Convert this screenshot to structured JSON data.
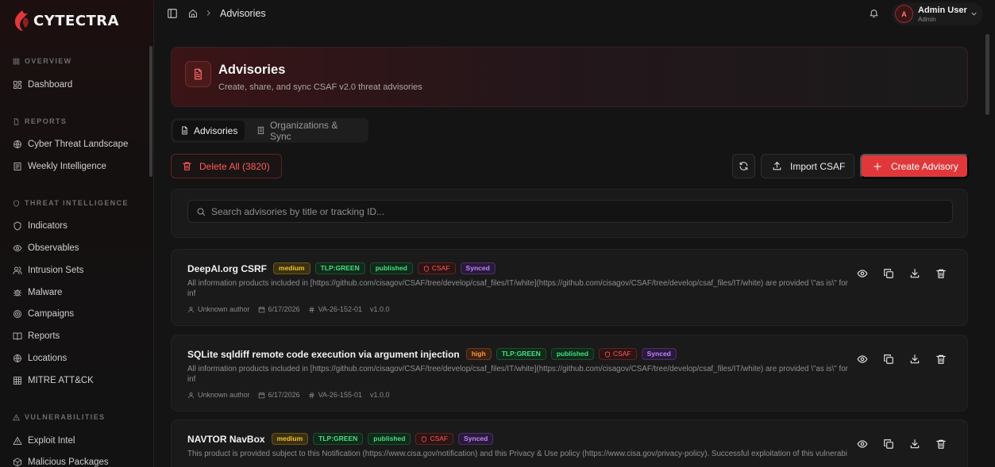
{
  "brand": {
    "name": "CYTECTRA",
    "accent": "#e0383a"
  },
  "sidebar": {
    "sections": [
      {
        "label": "OVERVIEW",
        "items": [
          "Dashboard"
        ]
      },
      {
        "label": "REPORTS",
        "items": [
          "Cyber Threat Landscape",
          "Weekly Intelligence"
        ]
      },
      {
        "label": "THREAT INTELLIGENCE",
        "items": [
          "Indicators",
          "Observables",
          "Intrusion Sets",
          "Malware",
          "Campaigns",
          "Reports",
          "Locations",
          "MITRE ATT&CK"
        ]
      },
      {
        "label": "VULNERABILITIES",
        "items": [
          "Exploit Intel",
          "Malicious Packages"
        ]
      }
    ]
  },
  "header": {
    "breadcrumb": "Advisories",
    "user_name": "Admin User",
    "user_role": "Admin",
    "avatar_initial": "A"
  },
  "hero": {
    "title": "Advisories",
    "subtitle": "Create, share, and sync CSAF v2.0 threat advisories"
  },
  "tabs": [
    {
      "label": "Advisories",
      "active": true
    },
    {
      "label": "Organizations & Sync",
      "active": false
    }
  ],
  "toolbar": {
    "delete_label": "Delete All (3820)",
    "import_label": "Import CSAF",
    "create_label": "Create Advisory"
  },
  "search": {
    "placeholder": "Search advisories by title or tracking ID..."
  },
  "advisories": [
    {
      "title": "DeepAI.org CSRF",
      "severity": "medium",
      "tlp": "TLP:GREEN",
      "status": "published",
      "format": "CSAF",
      "sync": "Synced",
      "description": "All information products included in [https://github.com/cisagov/CSAF/tree/develop/csaf_files/IT/white](https://github.com/cisagov/CSAF/tree/develop/csaf_files/IT/white) are provided \\\"as is\\\" for inf",
      "author": "Unknown author",
      "date": "6/17/2026",
      "tracking_id": "VA-26-152-01",
      "version": "v1.0.0"
    },
    {
      "title": "SQLite sqldiff remote code execution via argument injection",
      "severity": "high",
      "tlp": "TLP:GREEN",
      "status": "published",
      "format": "CSAF",
      "sync": "Synced",
      "description": "All information products included in [https://github.com/cisagov/CSAF/tree/develop/csaf_files/IT/white](https://github.com/cisagov/CSAF/tree/develop/csaf_files/IT/white) are provided \\\"as is\\\" for inf",
      "author": "Unknown author",
      "date": "6/17/2026",
      "tracking_id": "VA-26-155-01",
      "version": "v1.0.0"
    },
    {
      "title": "NAVTOR NavBox",
      "severity": "medium",
      "tlp": "TLP:GREEN",
      "status": "published",
      "format": "CSAF",
      "sync": "Synced",
      "description": "This product is provided subject to this Notification (https://www.cisa.gov/notification) and this Privacy & Use policy (https://www.cisa.gov/privacy-policy). Successful exploitation of this vulnerabi",
      "author": "",
      "date": "",
      "tracking_id": "",
      "version": ""
    }
  ]
}
